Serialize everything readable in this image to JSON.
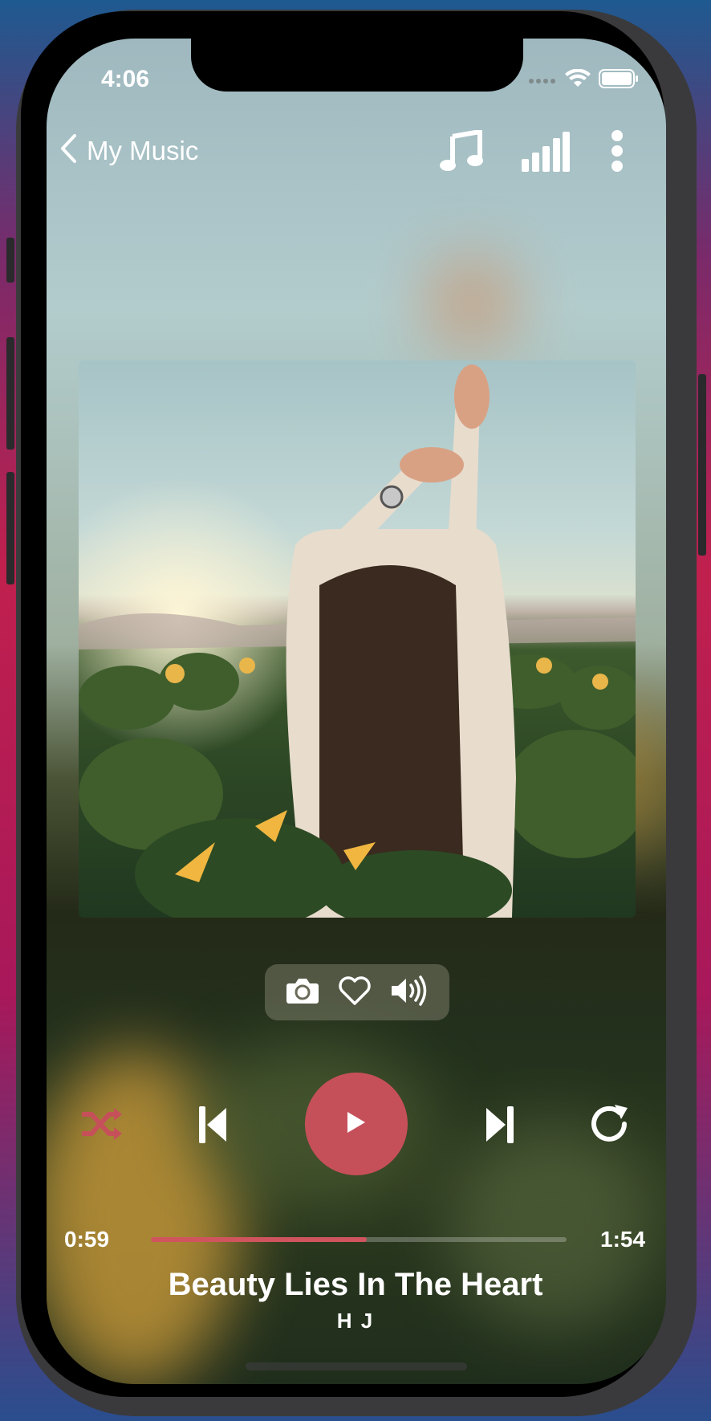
{
  "status_bar": {
    "time": "4:06"
  },
  "nav": {
    "back_label": "My Music"
  },
  "player": {
    "elapsed": "0:59",
    "duration": "1:54",
    "progress": 0.52,
    "title": "Beauty Lies In The Heart",
    "artist": "H J",
    "state": "paused"
  },
  "colors": {
    "accent": "#c6505a",
    "progress": "#d0545e"
  },
  "icons": {
    "top": [
      "music-note-icon",
      "signal-bars-icon",
      "more-vertical-icon"
    ],
    "mini": [
      "camera-icon",
      "heart-icon",
      "volume-icon"
    ],
    "controls": [
      "shuffle-icon",
      "skip-previous-icon",
      "play-icon",
      "skip-next-icon",
      "repeat-icon"
    ]
  }
}
